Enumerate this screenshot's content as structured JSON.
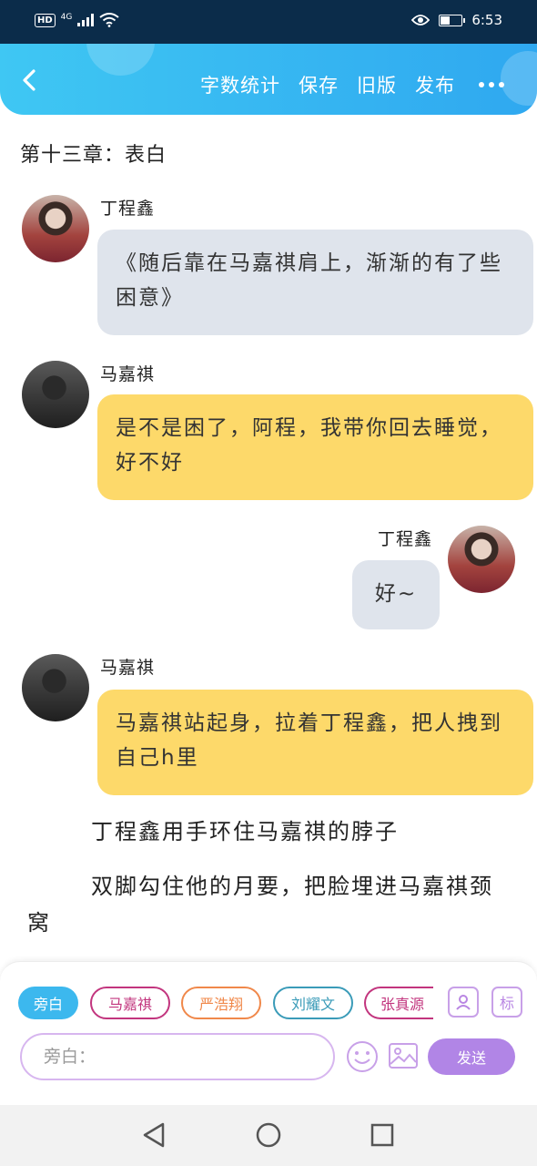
{
  "status_bar": {
    "network_hd": "HD",
    "network_type": "4G",
    "time": "6:53",
    "battery_level": 0.4
  },
  "header": {
    "actions": {
      "word_count": "字数统计",
      "save": "保存",
      "old_version": "旧版",
      "publish": "发布"
    }
  },
  "chapter": {
    "title": "第十三章：表白"
  },
  "messages": [
    {
      "speaker": "丁程鑫",
      "text": "《随后靠在马嘉祺肩上，渐渐的有了些困意》"
    },
    {
      "speaker": "马嘉祺",
      "text": "是不是困了，阿程，我带你回去睡觉，好不好"
    },
    {
      "speaker": "丁程鑫",
      "text": "好~"
    },
    {
      "speaker": "马嘉祺",
      "text": "马嘉祺站起身，拉着丁程鑫，把人拽到自己h里"
    }
  ],
  "narration": [
    "丁程鑫用手环住马嘉祺的脖子",
    "双脚勾住他的月要，把脸埋进马嘉祺颈窝"
  ],
  "input_panel": {
    "chips": [
      {
        "label": "旁白",
        "color": "#3cb8ee"
      },
      {
        "label": "马嘉祺",
        "color": "#c2357e"
      },
      {
        "label": "严浩翔",
        "color": "#f0884a"
      },
      {
        "label": "刘耀文",
        "color": "#3a9bb8"
      },
      {
        "label": "张真源",
        "color": "#c2357e"
      }
    ],
    "tag_button": "标",
    "placeholder": "旁白：",
    "send_label": "发送"
  },
  "colors": {
    "header_gradient_start": "#3fc7f3",
    "header_gradient_end": "#2fa8f0",
    "gray_bubble": "#dfe4ec",
    "yellow_bubble": "#fdd96a",
    "send_button": "#b185e6"
  }
}
